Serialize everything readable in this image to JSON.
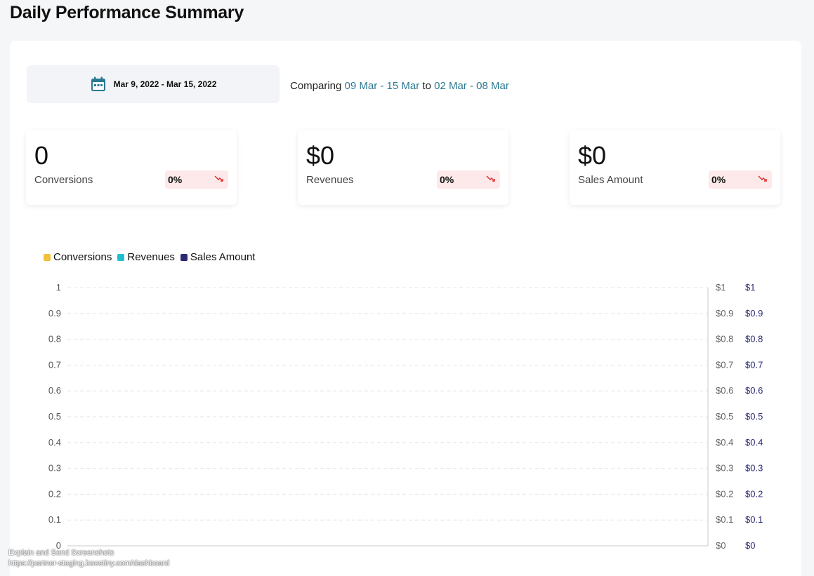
{
  "header": {
    "title": "Daily Performance Summary"
  },
  "date_picker": {
    "icon": "calendar-icon",
    "range": "Mar 9, 2022 - Mar 15, 2022"
  },
  "comparison": {
    "prefix": "Comparing",
    "current": "09 Mar - 15 Mar",
    "joiner": "to",
    "previous": "02 Mar - 08 Mar"
  },
  "cards": [
    {
      "value": "0",
      "label": "Conversions",
      "change": "0%",
      "trend": "down"
    },
    {
      "value": "$0",
      "label": "Revenues",
      "change": "0%",
      "trend": "down"
    },
    {
      "value": "$0",
      "label": "Sales Amount",
      "change": "0%",
      "trend": "down"
    }
  ],
  "colors": {
    "accent": "#2a7a93",
    "down": "#e03131",
    "down_bg": "#fde9e9"
  },
  "chart_data": {
    "type": "line",
    "title": "",
    "series": [
      {
        "name": "Conversions",
        "color": "#f2c13c",
        "values": []
      },
      {
        "name": "Revenues",
        "color": "#1fbfcf",
        "values": []
      },
      {
        "name": "Sales Amount",
        "color": "#2b2a73",
        "values": []
      }
    ],
    "y_left": {
      "ticks": [
        "1",
        "0.9",
        "0.8",
        "0.7",
        "0.6",
        "0.5",
        "0.4",
        "0.3",
        "0.2",
        "0.1",
        "0"
      ],
      "range": [
        0,
        1
      ]
    },
    "y_right_1": {
      "ticks": [
        "$1",
        "$0.9",
        "$0.8",
        "$0.7",
        "$0.6",
        "$0.5",
        "$0.4",
        "$0.3",
        "$0.2",
        "$0.1",
        "$0"
      ],
      "range": [
        0,
        1
      ]
    },
    "y_right_2": {
      "ticks": [
        "$1",
        "$0.9",
        "$0.8",
        "$0.7",
        "$0.6",
        "$0.5",
        "$0.4",
        "$0.3",
        "$0.2",
        "$0.1",
        "$0"
      ],
      "range": [
        0,
        1
      ]
    },
    "grid": true,
    "legend_position": "top-left"
  },
  "watermark": {
    "line1": "Explain and Send Screenshots",
    "line2": "https://partner-staging.boostiny.com/dashboard"
  }
}
